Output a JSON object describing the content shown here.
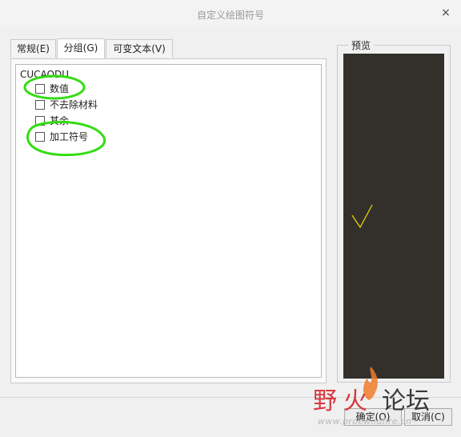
{
  "dialog": {
    "title": "自定义绘图符号",
    "close_glyph": "×"
  },
  "tabs": [
    {
      "label": "常规(E)",
      "active": false
    },
    {
      "label": "分组(G)",
      "active": true
    },
    {
      "label": "可变文本(V)",
      "active": false
    }
  ],
  "tree": {
    "root": "CUCAODU",
    "items": [
      {
        "label": "数值",
        "checked": false,
        "circled": true
      },
      {
        "label": "不去除材料",
        "checked": false,
        "circled": false
      },
      {
        "label": "其余",
        "checked": false,
        "circled": false
      },
      {
        "label": "加工符号",
        "checked": false,
        "circled": true
      }
    ]
  },
  "preview": {
    "label": "预览",
    "background": "#33302c",
    "symbol_color": "#e6d200"
  },
  "buttons": {
    "ok": "确定(O)",
    "cancel": "取消(C)"
  },
  "watermark": {
    "text_1": "野",
    "text_2": "火",
    "text_3": "论坛",
    "url": "www.proewildfire.cn"
  },
  "colors": {
    "annotation": "#33dd11",
    "watermark_red": "#d8383f",
    "flame": "#f07b2a"
  }
}
